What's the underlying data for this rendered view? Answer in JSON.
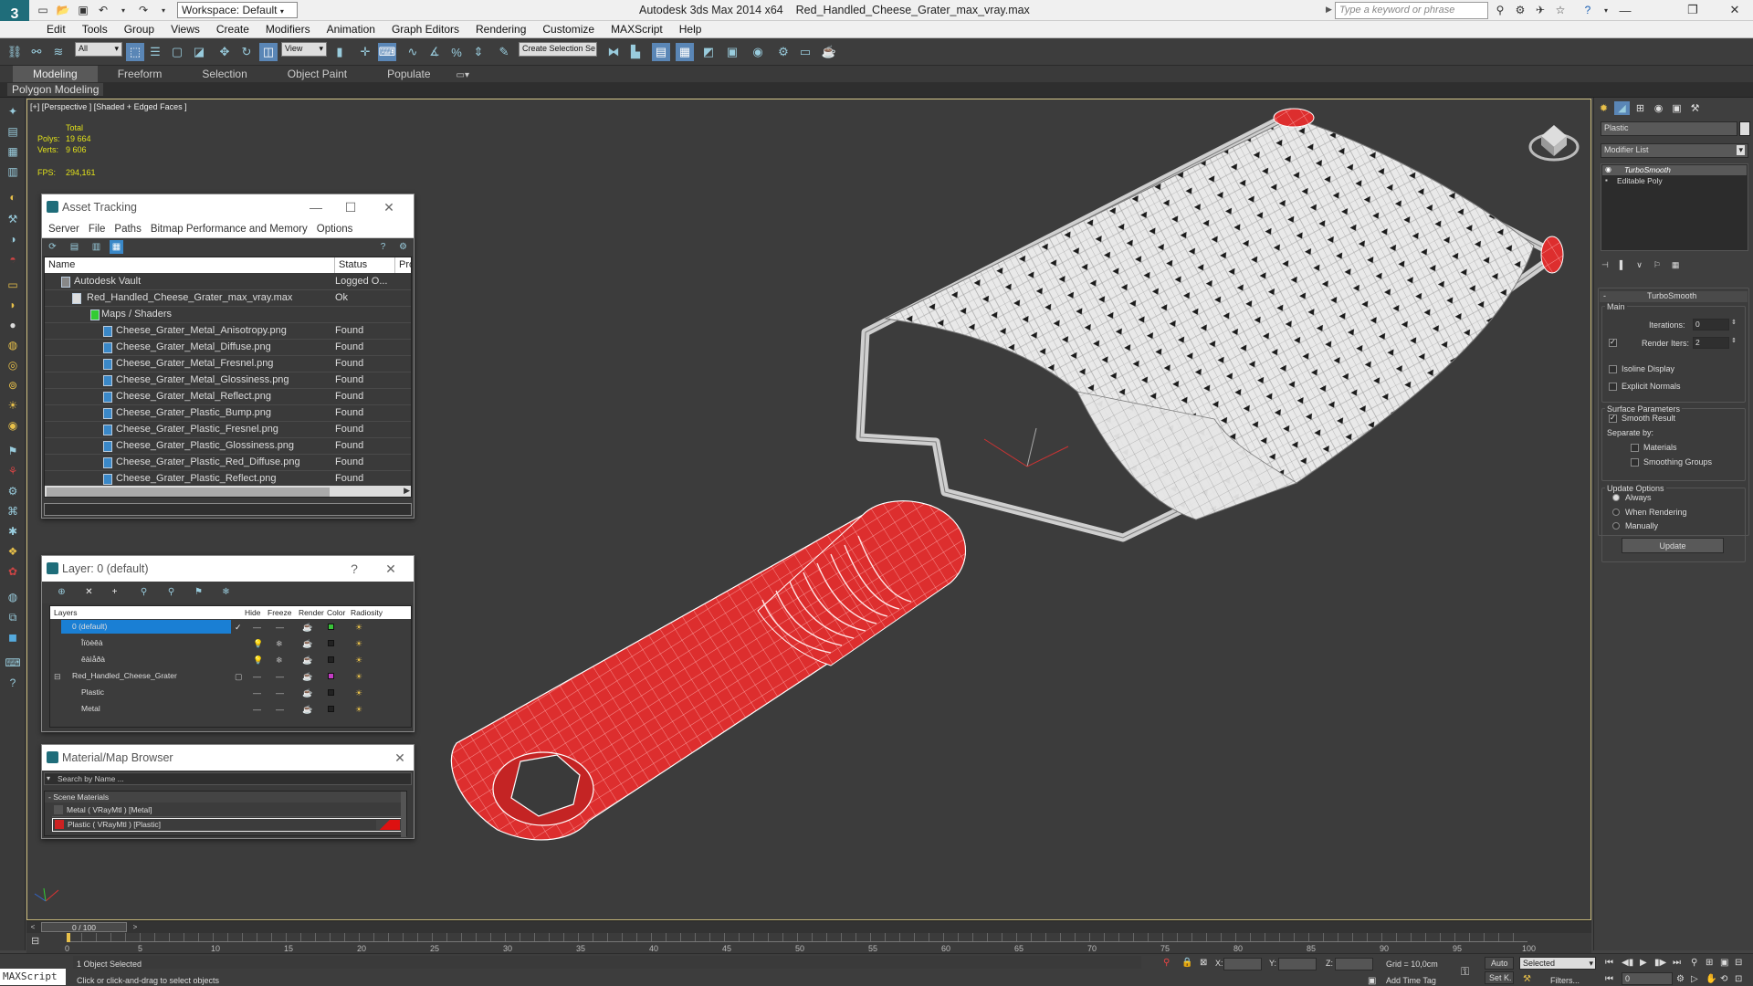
{
  "app": {
    "title": "Autodesk 3ds Max  2014 x64",
    "file": "Red_Handled_Cheese_Grater_max_vray.max",
    "workspace": "Workspace: Default",
    "search_placeholder": "Type a keyword or phrase"
  },
  "menu": [
    "Edit",
    "Tools",
    "Group",
    "Views",
    "Create",
    "Modifiers",
    "Animation",
    "Graph Editors",
    "Rendering",
    "Customize",
    "MAXScript",
    "Help"
  ],
  "toolbar": {
    "selection_filter": "All",
    "ref_coord": "View",
    "named_selection": "Create Selection Se"
  },
  "ribbon": {
    "tabs": [
      "Modeling",
      "Freeform",
      "Selection",
      "Object Paint",
      "Populate"
    ],
    "active_tab": "Modeling",
    "sub_label": "Polygon Modeling"
  },
  "viewport": {
    "label": "[+] [Perspective ] [Shaded + Edged Faces ]",
    "stats": {
      "total_label": "Total",
      "polys_label": "Polys:",
      "polys_value": "19 664",
      "verts_label": "Verts:",
      "verts_value": "9 606",
      "fps_label": "FPS:",
      "fps_value": "294,161"
    }
  },
  "asset_tracking": {
    "title": "Asset Tracking",
    "menu": [
      "Server",
      "File",
      "Paths",
      "Bitmap Performance and Memory",
      "Options"
    ],
    "columns": [
      "Name",
      "Status",
      "Pro"
    ],
    "rows": [
      {
        "name": "Autodesk Vault",
        "status": "Logged O..."
      },
      {
        "name": "Red_Handled_Cheese_Grater_max_vray.max",
        "status": "Ok"
      },
      {
        "name": "Maps / Shaders",
        "status": ""
      },
      {
        "name": "Cheese_Grater_Metal_Anisotropy.png",
        "status": "Found"
      },
      {
        "name": "Cheese_Grater_Metal_Diffuse.png",
        "status": "Found"
      },
      {
        "name": "Cheese_Grater_Metal_Fresnel.png",
        "status": "Found"
      },
      {
        "name": "Cheese_Grater_Metal_Glossiness.png",
        "status": "Found"
      },
      {
        "name": "Cheese_Grater_Metal_Reflect.png",
        "status": "Found"
      },
      {
        "name": "Cheese_Grater_Plastic_Bump.png",
        "status": "Found"
      },
      {
        "name": "Cheese_Grater_Plastic_Fresnel.png",
        "status": "Found"
      },
      {
        "name": "Cheese_Grater_Plastic_Glossiness.png",
        "status": "Found"
      },
      {
        "name": "Cheese_Grater_Plastic_Red_Diffuse.png",
        "status": "Found"
      },
      {
        "name": "Cheese_Grater_Plastic_Reflect.png",
        "status": "Found"
      }
    ]
  },
  "layer_panel": {
    "title": "Layer: 0 (default)",
    "help": "?",
    "columns": [
      "Layers",
      "Hide",
      "Freeze",
      "Render",
      "Color",
      "Radiosity"
    ],
    "rows": [
      {
        "name": "0 (default)",
        "color": "#39c339"
      },
      {
        "name": "Îïòèêà",
        "color": "#222222"
      },
      {
        "name": "êàìåðà",
        "color": "#222222"
      },
      {
        "name": "Red_Handled_Cheese_Grater",
        "color": "#c33cc3"
      },
      {
        "name": "Plastic",
        "color": "#222222"
      },
      {
        "name": "Metal",
        "color": "#222222"
      }
    ]
  },
  "material_browser": {
    "title": "Material/Map Browser",
    "search_placeholder": "Search by Name ...",
    "group": "- Scene Materials",
    "items": [
      "Metal  ( VRayMtl ) [Metal]",
      "Plastic  ( VRayMtl ) [Plastic]"
    ]
  },
  "command_panel": {
    "object_name": "Plastic",
    "modifier_list": "Modifier List",
    "stack": [
      "TurboSmooth",
      "Editable Poly"
    ],
    "rollout": "TurboSmooth",
    "main_label": "Main",
    "iterations_label": "Iterations:",
    "iterations_value": "0",
    "render_iters_label": "Render Iters:",
    "render_iters_value": "2",
    "isoline": "Isoline Display",
    "explicit": "Explicit Normals",
    "surface_params": "Surface Parameters",
    "smooth_result": "Smooth Result",
    "separate_by": "Separate by:",
    "materials": "Materials",
    "smoothing_groups": "Smoothing Groups",
    "update_options": "Update Options",
    "always": "Always",
    "when_rendering": "When Rendering",
    "manually": "Manually",
    "update_btn": "Update"
  },
  "timeline": {
    "frame": "0 / 100",
    "ticks": [
      "0",
      "5",
      "10",
      "15",
      "20",
      "25",
      "30",
      "35",
      "40",
      "45",
      "50",
      "55",
      "60",
      "65",
      "70",
      "75",
      "80",
      "85",
      "90",
      "95",
      "100"
    ]
  },
  "status": {
    "maxscript": "MAXScript",
    "selected": "1 Object Selected",
    "prompt": "Click or click-and-drag to select objects",
    "x_label": "X:",
    "y_label": "Y:",
    "z_label": "Z:",
    "grid": "Grid = 10,0cm",
    "add_time_tag": "Add Time Tag",
    "auto": "Auto",
    "set_k": "Set K.",
    "selected_drop": "Selected",
    "filters": "Filters...",
    "frame_field": "0"
  }
}
